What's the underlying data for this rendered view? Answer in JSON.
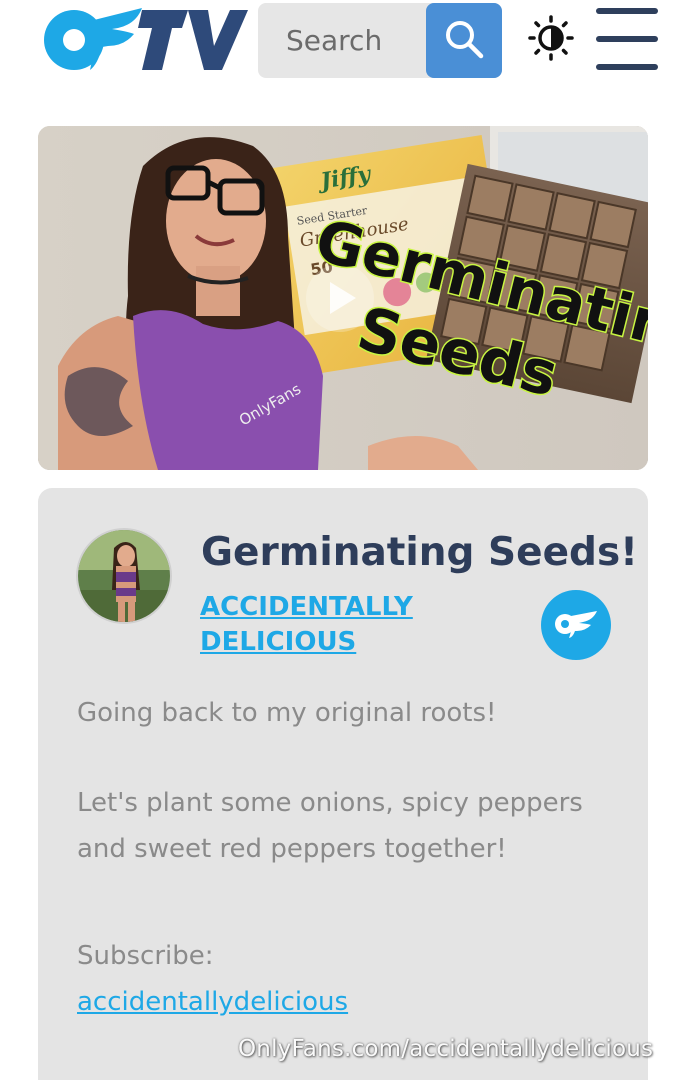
{
  "header": {
    "logo_text": "OFTV",
    "search_placeholder": "Search"
  },
  "hero": {
    "overlay_line1": "Germinating",
    "overlay_line2": "Seeds",
    "box_brand": "Jiffy",
    "box_subtitle": "Seed Starter",
    "box_title": "Greenhouse",
    "box_count": "50",
    "shirt_text": "OnlyFans"
  },
  "video": {
    "title": "Germinating Seeds!",
    "creator_line1": "ACCIDENTALLY",
    "creator_line2": "DELICIOUS",
    "description_line1": "Going back to my original roots!",
    "description_line2": "Let's plant some onions, spicy peppers",
    "description_line3": "and sweet red peppers together!",
    "subscribe_label": "Subscribe:",
    "subscribe_link": "accidentallydelicious"
  },
  "watermark": "OnlyFans.com/accidentallydelicious",
  "colors": {
    "brand_blue": "#1ea8e6",
    "navy": "#2e3d5a",
    "search_button": "#4a8fd6",
    "card_bg": "#e4e4e4",
    "overlay_green": "#c8f542"
  },
  "icons": [
    "search-icon",
    "sun-icon",
    "hamburger-menu-icon",
    "onlyfans-logo-icon",
    "play-icon"
  ]
}
